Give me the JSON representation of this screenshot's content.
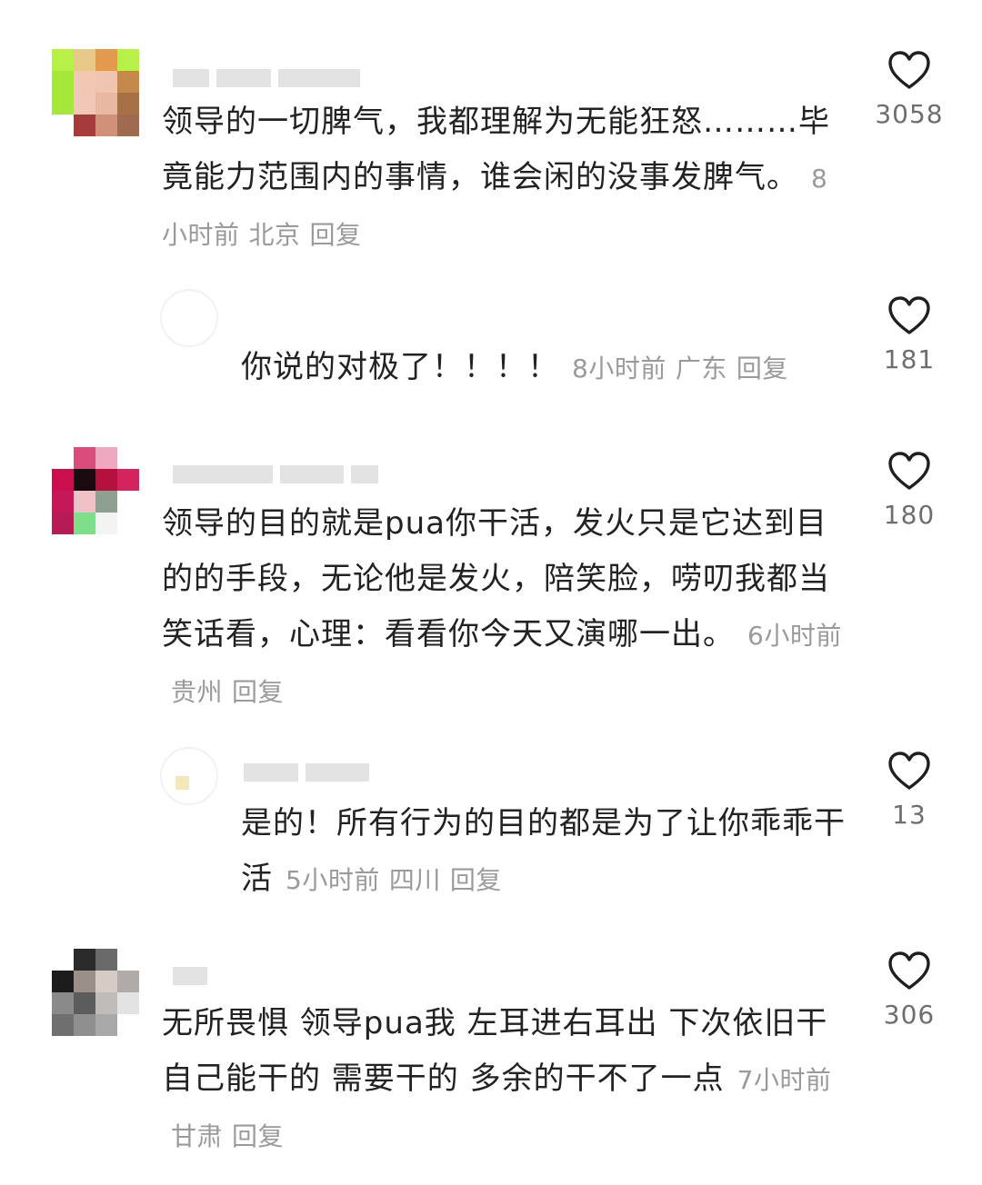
{
  "comments": [
    {
      "text": "领导的一切脾气，我都理解为无能狂怒………毕竟能力范围内的事情，谁会闲的没事发脾气。",
      "time": "8小时前",
      "location": "北京",
      "reply_label": "回复",
      "likes": "3058",
      "replies": [
        {
          "text": "你说的对极了！！！！",
          "time": "8小时前",
          "location": "广东",
          "reply_label": "回复",
          "likes": "181"
        }
      ]
    },
    {
      "text": "领导的目的就是pua你干活，发火只是它达到目的的手段，无论他是发火，陪笑脸，唠叨我都当笑话看，心理：看看你今天又演哪一出。",
      "time": "6小时前",
      "location": "贵州",
      "reply_label": "回复",
      "likes": "180",
      "replies": [
        {
          "text": "是的！所有行为的目的都是为了让你乖乖干活",
          "time": "5小时前",
          "location": "四川",
          "reply_label": "回复",
          "likes": "13"
        }
      ]
    },
    {
      "text": "无所畏惧 领导pua我 左耳进右耳出 下次依旧干自己能干的 需要干的 多余的干不了一点",
      "time": "7小时前",
      "location": "甘肃",
      "reply_label": "回复",
      "likes": "306"
    }
  ],
  "icons": {
    "like": "heart-outline-icon"
  },
  "colors": {
    "text": "#222222",
    "meta": "#9a9a9a",
    "count": "#6e6e6e"
  }
}
